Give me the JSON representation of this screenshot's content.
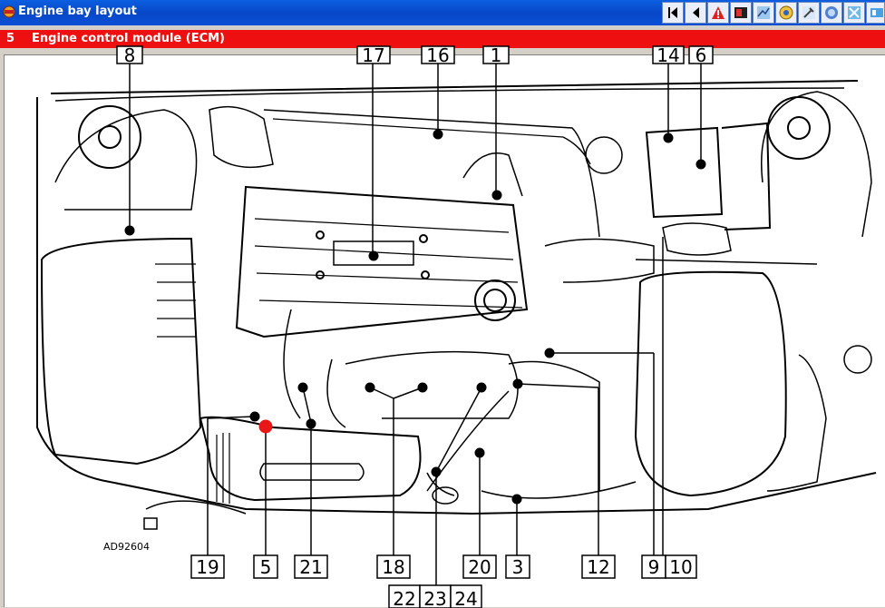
{
  "window": {
    "title": "Engine bay layout"
  },
  "toolbar": {
    "buttons": [
      {
        "icon": "first-page-icon"
      },
      {
        "icon": "previous-page-icon"
      },
      {
        "icon": "warning-icon"
      },
      {
        "icon": "component-icon"
      },
      {
        "icon": "diagram-icon"
      },
      {
        "icon": "gauge-icon"
      },
      {
        "icon": "tool-icon"
      },
      {
        "icon": "ecm-icon"
      },
      {
        "icon": "wiring-icon"
      },
      {
        "icon": "settings-icon"
      }
    ]
  },
  "selection": {
    "number": "5",
    "label": "Engine control module (ECM)"
  },
  "diagram": {
    "reference": "AD92604",
    "top_callouts": [
      "8",
      "17",
      "16",
      "1",
      "14",
      "6"
    ],
    "bottom_callouts": [
      "19",
      "5",
      "21",
      "18",
      "20",
      "3",
      "12",
      "9",
      "10"
    ],
    "lower_callouts": [
      "22",
      "23",
      "24"
    ],
    "highlighted": "5",
    "colors": {
      "highlight": "#e81818",
      "line": "#000000"
    }
  }
}
